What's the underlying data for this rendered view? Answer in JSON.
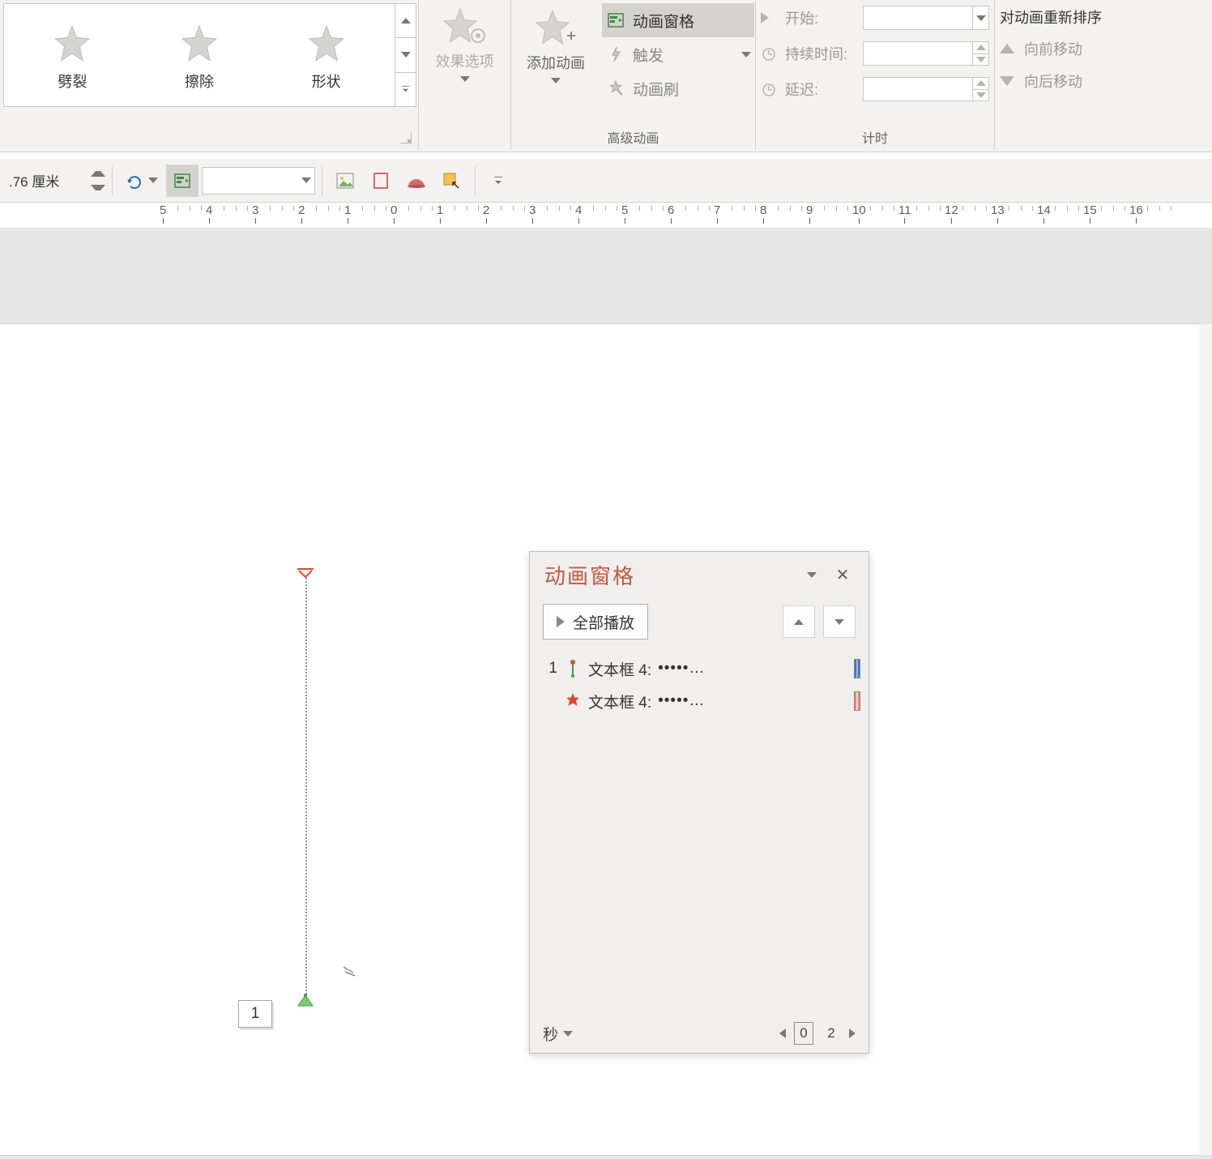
{
  "ribbon": {
    "gallery": {
      "items": [
        {
          "label": "劈裂"
        },
        {
          "label": "擦除"
        },
        {
          "label": "形状"
        }
      ]
    },
    "effect_options": {
      "label": "效果选项"
    },
    "advanced": {
      "add_animation": "添加动画",
      "pane": "动画窗格",
      "trigger": "触发",
      "painter": "动画刷",
      "group_label": "高级动画"
    },
    "timing": {
      "start_label": "开始:",
      "start_value": "",
      "duration_label": "持续时间:",
      "duration_value": "",
      "delay_label": "延迟:",
      "delay_value": "",
      "group_label": "计时"
    },
    "reorder": {
      "title": "对动画重新排序",
      "up": "向前移动",
      "down": "向后移动"
    }
  },
  "qat": {
    "size_value": ".76 厘米"
  },
  "ruler": {
    "ticks": [
      -5,
      -4,
      -3,
      -2,
      -1,
      0,
      1,
      2,
      3,
      4,
      5,
      6,
      7,
      8,
      9,
      10,
      11,
      12,
      13,
      14,
      15,
      16
    ]
  },
  "slide": {
    "animation_tag": "1"
  },
  "animation_pane": {
    "title": "动画窗格",
    "play_all": "全部播放",
    "items": [
      {
        "num": "1",
        "icon": "motion",
        "name": "文本框 4:",
        "dots": "•••••…"
      },
      {
        "num": "",
        "icon": "emphasis",
        "name": "文本框 4:",
        "dots": "•••••…"
      }
    ],
    "footer_label": "秒",
    "footer_ticks": [
      "0",
      "2"
    ]
  }
}
